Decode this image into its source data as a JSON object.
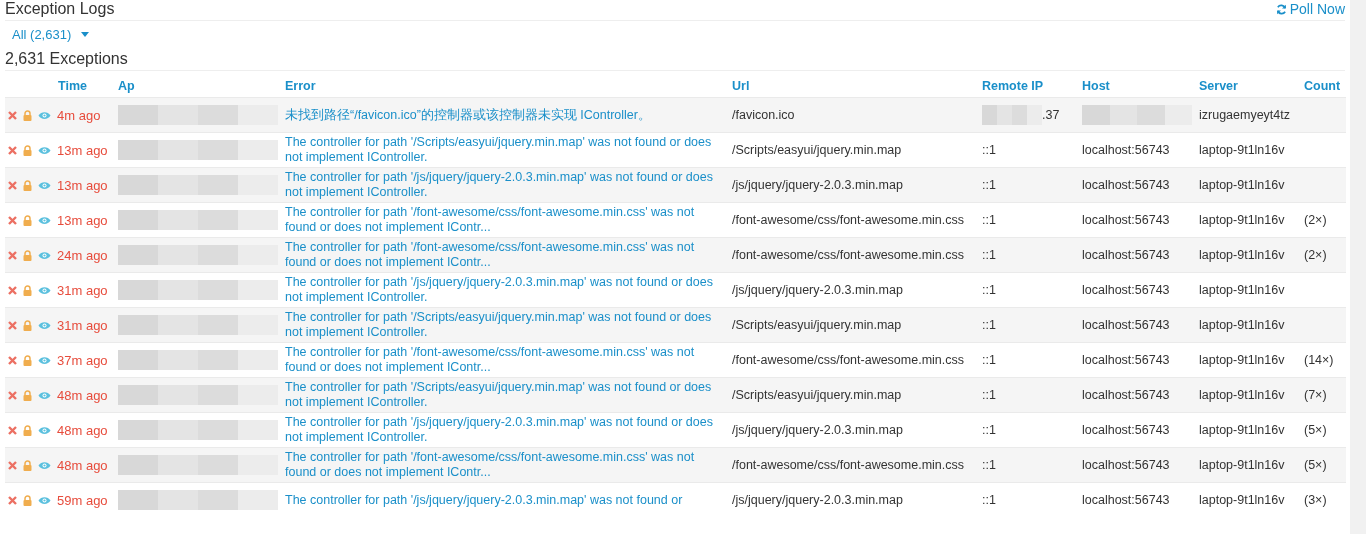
{
  "page": {
    "title": "Exception Logs",
    "poll_button": "Poll Now"
  },
  "filter": {
    "label": "All (2,631)"
  },
  "summary": "2,631 Exceptions",
  "table": {
    "columns": [
      "Time",
      "Ap",
      "Error",
      "Url",
      "Remote IP",
      "Host",
      "Server",
      "Count"
    ],
    "rows": [
      {
        "time": "4m ago",
        "error": "未找到路径“/favicon.ico”的控制器或该控制器未实现 IController。",
        "url": "/favicon.ico",
        "remote_ip": ".37",
        "ip_masked": true,
        "server": "izrugaemyeyt4tz"
      },
      {
        "time": "13m ago",
        "error": "The controller for path '/Scripts/easyui/jquery.min.map' was not found or does not implement IController.",
        "url": "/Scripts/easyui/jquery.min.map",
        "remote_ip": "::1",
        "ip_masked": false,
        "host": "localhost:56743",
        "server": "laptop-9t1ln16v"
      },
      {
        "time": "13m ago",
        "error": "The controller for path '/js/jquery/jquery-2.0.3.min.map' was not found or does not implement IController.",
        "url": "/js/jquery/jquery-2.0.3.min.map",
        "remote_ip": "::1",
        "ip_masked": false,
        "host": "localhost:56743",
        "server": "laptop-9t1ln16v"
      },
      {
        "time": "13m ago",
        "error": "The controller for path '/font-awesome/css/font-awesome.min.css' was not found or does not implement IContr...",
        "url": "/font-awesome/css/font-awesome.min.css",
        "remote_ip": "::1",
        "ip_masked": false,
        "host": "localhost:56743",
        "server": "laptop-9t1ln16v",
        "count": "(2×)"
      },
      {
        "time": "24m ago",
        "error": "The controller for path '/font-awesome/css/font-awesome.min.css' was not found or does not implement IContr...",
        "url": "/font-awesome/css/font-awesome.min.css",
        "remote_ip": "::1",
        "ip_masked": false,
        "host": "localhost:56743",
        "server": "laptop-9t1ln16v",
        "count": "(2×)"
      },
      {
        "time": "31m ago",
        "error": "The controller for path '/js/jquery/jquery-2.0.3.min.map' was not found or does not implement IController.",
        "url": "/js/jquery/jquery-2.0.3.min.map",
        "remote_ip": "::1",
        "ip_masked": false,
        "host": "localhost:56743",
        "server": "laptop-9t1ln16v"
      },
      {
        "time": "31m ago",
        "error": "The controller for path '/Scripts/easyui/jquery.min.map' was not found or does not implement IController.",
        "url": "/Scripts/easyui/jquery.min.map",
        "remote_ip": "::1",
        "ip_masked": false,
        "host": "localhost:56743",
        "server": "laptop-9t1ln16v"
      },
      {
        "time": "37m ago",
        "error": "The controller for path '/font-awesome/css/font-awesome.min.css' was not found or does not implement IContr...",
        "url": "/font-awesome/css/font-awesome.min.css",
        "remote_ip": "::1",
        "ip_masked": false,
        "host": "localhost:56743",
        "server": "laptop-9t1ln16v",
        "count": "(14×)"
      },
      {
        "time": "48m ago",
        "error": "The controller for path '/Scripts/easyui/jquery.min.map' was not found or does not implement IController.",
        "url": "/Scripts/easyui/jquery.min.map",
        "remote_ip": "::1",
        "ip_masked": false,
        "host": "localhost:56743",
        "server": "laptop-9t1ln16v",
        "count": "(7×)"
      },
      {
        "time": "48m ago",
        "error": "The controller for path '/js/jquery/jquery-2.0.3.min.map' was not found or does not implement IController.",
        "url": "/js/jquery/jquery-2.0.3.min.map",
        "remote_ip": "::1",
        "ip_masked": false,
        "host": "localhost:56743",
        "server": "laptop-9t1ln16v",
        "count": "(5×)"
      },
      {
        "time": "48m ago",
        "error": "The controller for path '/font-awesome/css/font-awesome.min.css' was not found or does not implement IContr...",
        "url": "/font-awesome/css/font-awesome.min.css",
        "remote_ip": "::1",
        "ip_masked": false,
        "host": "localhost:56743",
        "server": "laptop-9t1ln16v",
        "count": "(5×)"
      },
      {
        "time": "59m ago",
        "error": "The controller for path '/js/jquery/jquery-2.0.3.min.map' was not found or",
        "url": "/js/jquery/jquery-2.0.3.min.map",
        "remote_ip": "::1",
        "ip_masked": false,
        "host": "localhost:56743",
        "server": "laptop-9t1ln16v",
        "count": "(3×)"
      }
    ]
  }
}
